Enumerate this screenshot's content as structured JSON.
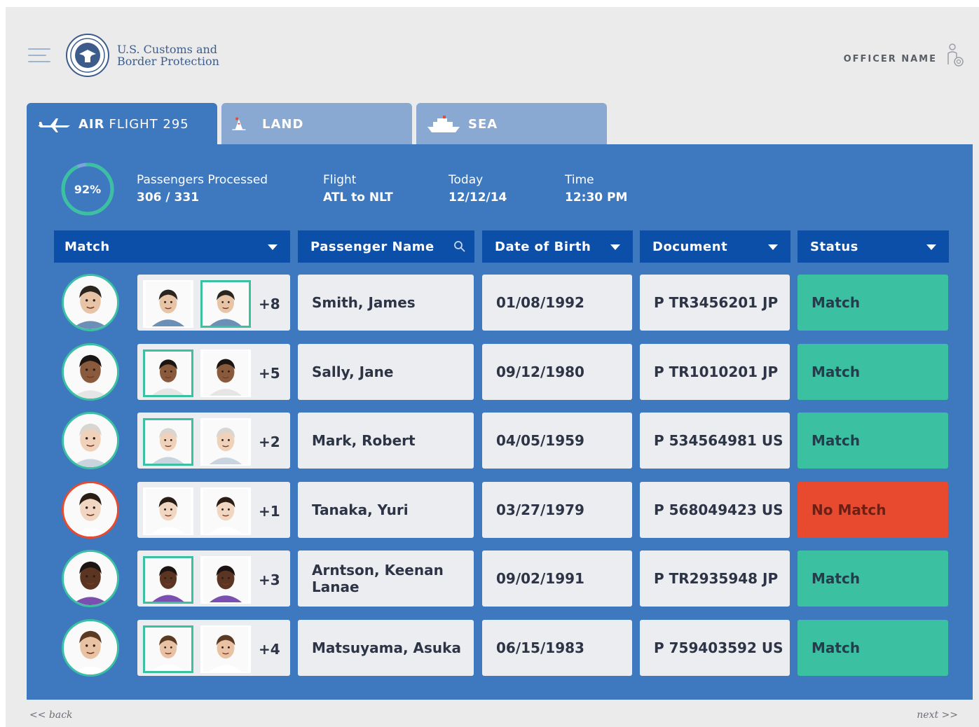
{
  "header": {
    "logo_line1": "U.S. Customs and",
    "logo_line2": "Border Protection",
    "officer_label": "OFFICER NAME",
    "icons": [
      "menu-icon",
      "cbp-seal-icon",
      "officer-gear-icon"
    ]
  },
  "tabs": [
    {
      "bold": "AIR",
      "light": "FLIGHT 295",
      "icon": "airplane-icon"
    },
    {
      "bold": "LAND",
      "light": "",
      "icon": "land-icon"
    },
    {
      "bold": "SEA",
      "light": "",
      "icon": "ship-icon"
    }
  ],
  "summary": {
    "progress_percent": 92,
    "progress_label": "92%",
    "processed_label": "Passengers Processed",
    "processed_value": "306 / 331",
    "flight_label": "Flight",
    "flight_value": "ATL to NLT",
    "today_label": "Today",
    "today_value": "12/12/14",
    "time_label": "Time",
    "time_value": "12:30 PM"
  },
  "columns": {
    "match": "Match",
    "name": "Passenger Name",
    "dob": "Date of Birth",
    "document": "Document",
    "status": "Status"
  },
  "rows": [
    {
      "more": "+8",
      "name": "Smith, James",
      "dob": "01/08/1992",
      "document": "P TR3456201 JP",
      "status": "Match"
    },
    {
      "more": "+5",
      "name": "Sally, Jane",
      "dob": "09/12/1980",
      "document": "P TR1010201 JP",
      "status": "Match"
    },
    {
      "more": "+2",
      "name": "Mark, Robert",
      "dob": "04/05/1959",
      "document": "P 534564981 US",
      "status": "Match"
    },
    {
      "more": "+1",
      "name": "Tanaka, Yuri",
      "dob": "03/27/1979",
      "document": "P 568049423 US",
      "status": "No Match"
    },
    {
      "more": "+3",
      "name": "Arntson, Keenan Lanae",
      "dob": "09/02/1991",
      "document": "P TR2935948 JP",
      "status": "Match"
    },
    {
      "more": "+4",
      "name": "Matsuyama, Asuka",
      "dob": "06/15/1983",
      "document": "P 759403592 US",
      "status": "Match"
    }
  ],
  "footer": {
    "back": "<< back",
    "next": "next >>"
  },
  "colors": {
    "panel": "#3e78bf",
    "header_bar": "#0b4fa8",
    "match": "#3bc1a2",
    "no_match": "#e84a2f"
  }
}
